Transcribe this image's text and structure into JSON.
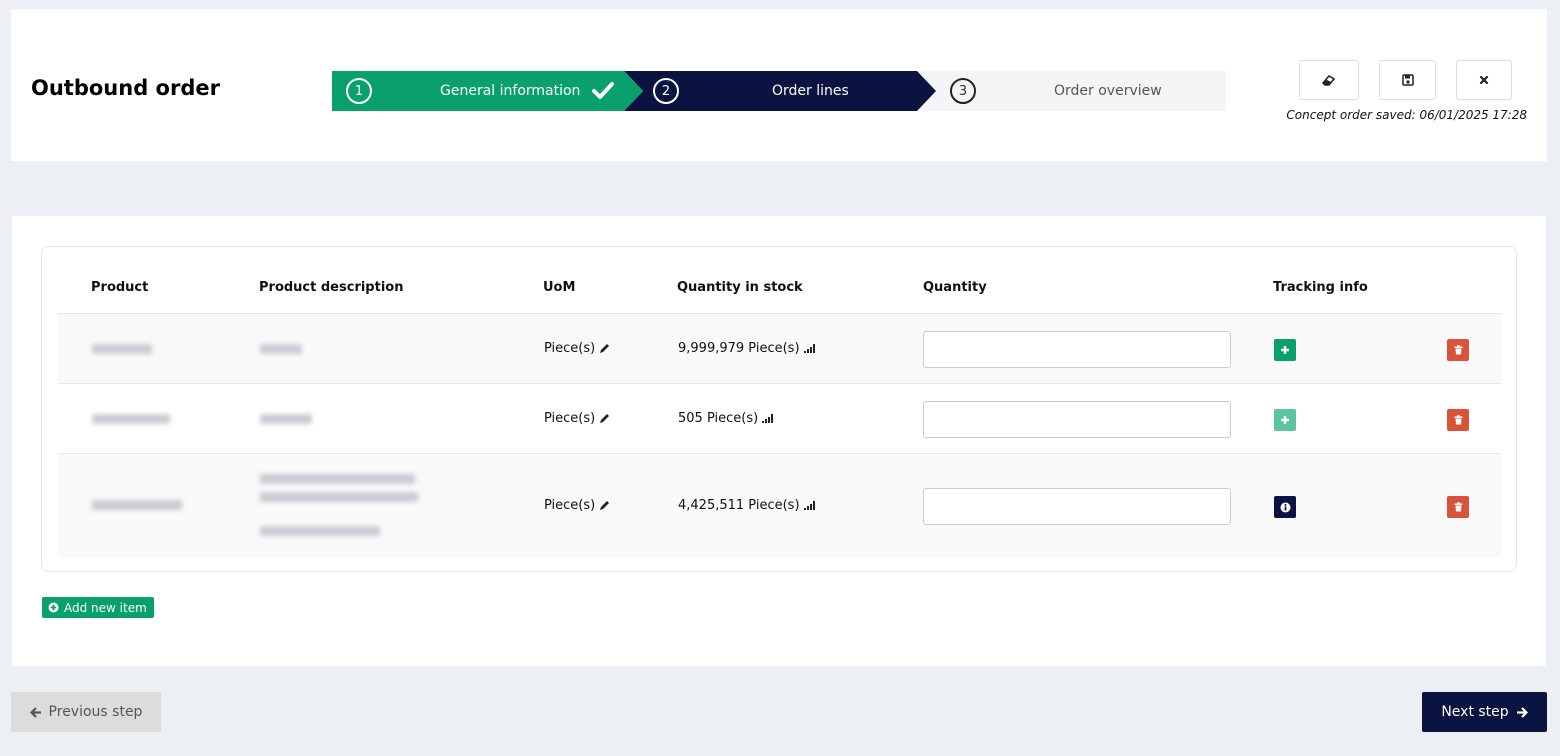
{
  "header": {
    "title": "Outbound order",
    "steps": [
      {
        "number": "1",
        "label": "General information",
        "state": "done"
      },
      {
        "number": "2",
        "label": "Order lines",
        "state": "active"
      },
      {
        "number": "3",
        "label": "Order overview",
        "state": "pending"
      }
    ],
    "actions": [
      {
        "icon": "eraser-icon",
        "name": "clear-button"
      },
      {
        "icon": "save-icon",
        "name": "save-button"
      },
      {
        "icon": "close-icon",
        "name": "close-button"
      }
    ],
    "saved_text": "Concept order saved: 06/01/2025 17:28"
  },
  "table": {
    "columns": [
      "Product",
      "Product description",
      "UoM",
      "Quantity in stock",
      "Quantity",
      "Tracking info"
    ],
    "rows": [
      {
        "uom": "Piece(s)",
        "stock": "9,999,979 Piece(s)",
        "quantity": "",
        "tracking_icon": "plus-icon"
      },
      {
        "uom": "Piece(s)",
        "stock": "505 Piece(s)",
        "quantity": "",
        "tracking_icon": "plus-icon"
      },
      {
        "uom": "Piece(s)",
        "stock": "4,425,511 Piece(s)",
        "quantity": "",
        "tracking_icon": "info-icon"
      }
    ],
    "add_label": "Add new item"
  },
  "footer": {
    "prev_label": "Previous step",
    "next_label": "Next step"
  },
  "colors": {
    "accent_green": "#0aa06e",
    "navy": "#0b1340",
    "danger": "#d9533a"
  }
}
